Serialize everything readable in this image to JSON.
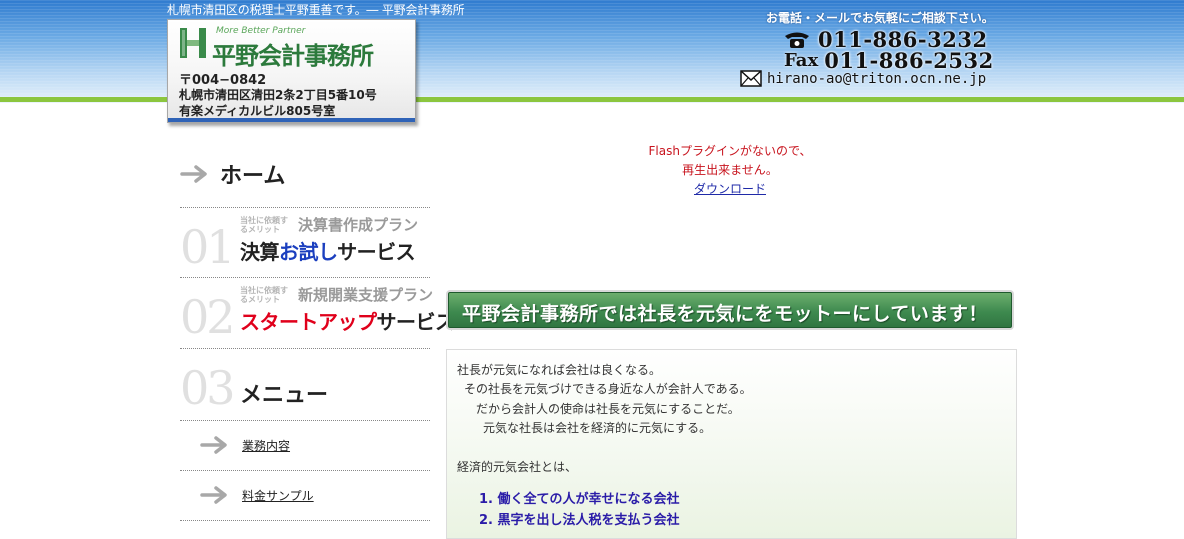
{
  "header": {
    "tagline": "札幌市清田区の税理士平野重善です。― 平野会計事務所",
    "logo": {
      "subtitle": "More Better Partner",
      "name": "平野会計事務所",
      "postal": "〒004−0842",
      "address_line1": "札幌市清田区清田2条2丁目5番10号",
      "address_line2": "有楽メディカルビル805号室"
    },
    "contact": {
      "note": "お電話・メールでお気軽にご相談下さい。",
      "tel": "011-886-3232",
      "fax_label": "Fax",
      "fax": "011-886-2532",
      "email": "hirano-ao@triton.ocn.ne.jp"
    }
  },
  "nav": {
    "home_label": "ホーム",
    "plans": [
      {
        "num": "01",
        "small": "当社に依頼するメリット",
        "sub": "決算書作成プラン",
        "main_a": "決算",
        "main_b": "お試し",
        "main_c": "サービス"
      },
      {
        "num": "02",
        "small": "当社に依頼するメリット",
        "sub": "新規開業支援プラン",
        "main_a": "スタートアップ",
        "main_b": "サービス"
      }
    ],
    "menu": {
      "num": "03",
      "label": "メニュー"
    },
    "sub_items": [
      "業務内容",
      "料金サンプル"
    ]
  },
  "flash": {
    "line1": "Flashプラグインがないので、",
    "line2": "再生出来ません。",
    "download_link": "ダウンロード"
  },
  "motto": "平野会計事務所では社長を元気にをモットーにしています！",
  "content": {
    "lines": [
      "社長が元気になれば会社は良くなる。",
      "その社長を元気づけできる身近な人が会計人である。",
      "だから会計人の使命は社長を元気にすることだ。",
      "元気な社長は会社を経済的に元気にする。"
    ],
    "heading": "経済的元気会社とは、",
    "list": [
      "1. 働く全ての人が幸せになる会社",
      "2. 黒字を出し法人税を支払う会社"
    ]
  },
  "colors": {
    "header_blue": "#2f7bcf",
    "accent_green": "#8cc63f",
    "motto_green": "#3e8a4f",
    "link_blue": "#1f2aa8",
    "flash_red": "#c8141e"
  }
}
